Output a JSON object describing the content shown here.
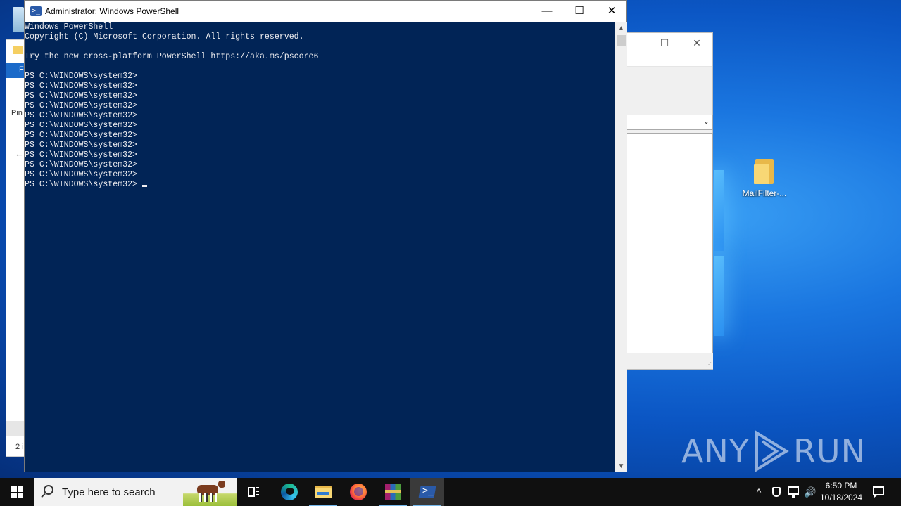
{
  "desktop": {
    "icons": [
      {
        "label": "MailFilter-..."
      }
    ],
    "watermark": {
      "left": "ANY",
      "right": "RUN"
    }
  },
  "explorer_left": {
    "ribbon_tab": "F",
    "nav_label": "Pin",
    "status_count": "2 i"
  },
  "powershell": {
    "title": "Administrator: Windows PowerShell",
    "icon": "powershell-icon",
    "console_lines": [
      "Windows PowerShell",
      "Copyright (C) Microsoft Corporation. All rights reserved.",
      "",
      "Try the new cross-platform PowerShell https://aka.ms/pscore6",
      "",
      "PS C:\\WINDOWS\\system32>",
      "PS C:\\WINDOWS\\system32>",
      "PS C:\\WINDOWS\\system32>",
      "PS C:\\WINDOWS\\system32>",
      "PS C:\\WINDOWS\\system32>",
      "PS C:\\WINDOWS\\system32>",
      "PS C:\\WINDOWS\\system32>",
      "PS C:\\WINDOWS\\system32>",
      "PS C:\\WINDOWS\\system32>",
      "PS C:\\WINDOWS\\system32>",
      "PS C:\\WINDOWS\\system32>"
    ],
    "active_prompt": "PS C:\\WINDOWS\\system32>"
  },
  "taskbar": {
    "search_placeholder": "Type here to search",
    "apps": [
      "task-view",
      "microsoft-edge",
      "file-explorer",
      "firefox",
      "winrar",
      "windows-powershell"
    ],
    "active_app": "windows-powershell",
    "tray": {
      "time": "6:50 PM",
      "date": "10/18/2024",
      "chevron": "^"
    }
  },
  "colors": {
    "console_bg": "#012456",
    "console_fg": "#eeedf0",
    "taskbar_bg": "#101010",
    "accent": "#76b9ed"
  }
}
